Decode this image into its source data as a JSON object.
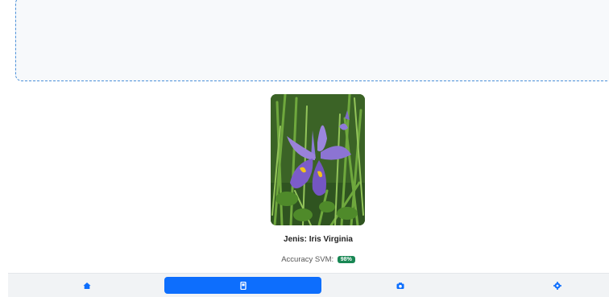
{
  "result": {
    "title": "Jenis: Iris Virginia",
    "accuracy_label": "Accuracy SVM:",
    "accuracy_value": "98%"
  },
  "preview_image": {
    "icon": "iris-flower-photo"
  },
  "nav": {
    "items": [
      {
        "icon": "home-icon",
        "active": false
      },
      {
        "icon": "phone-icon",
        "active": true
      },
      {
        "icon": "camera-icon",
        "active": false
      },
      {
        "icon": "gear-icon",
        "active": false
      }
    ]
  },
  "colors": {
    "accent": "#0d6efd",
    "badge": "#198754",
    "dashed_border": "#4a90d9"
  }
}
